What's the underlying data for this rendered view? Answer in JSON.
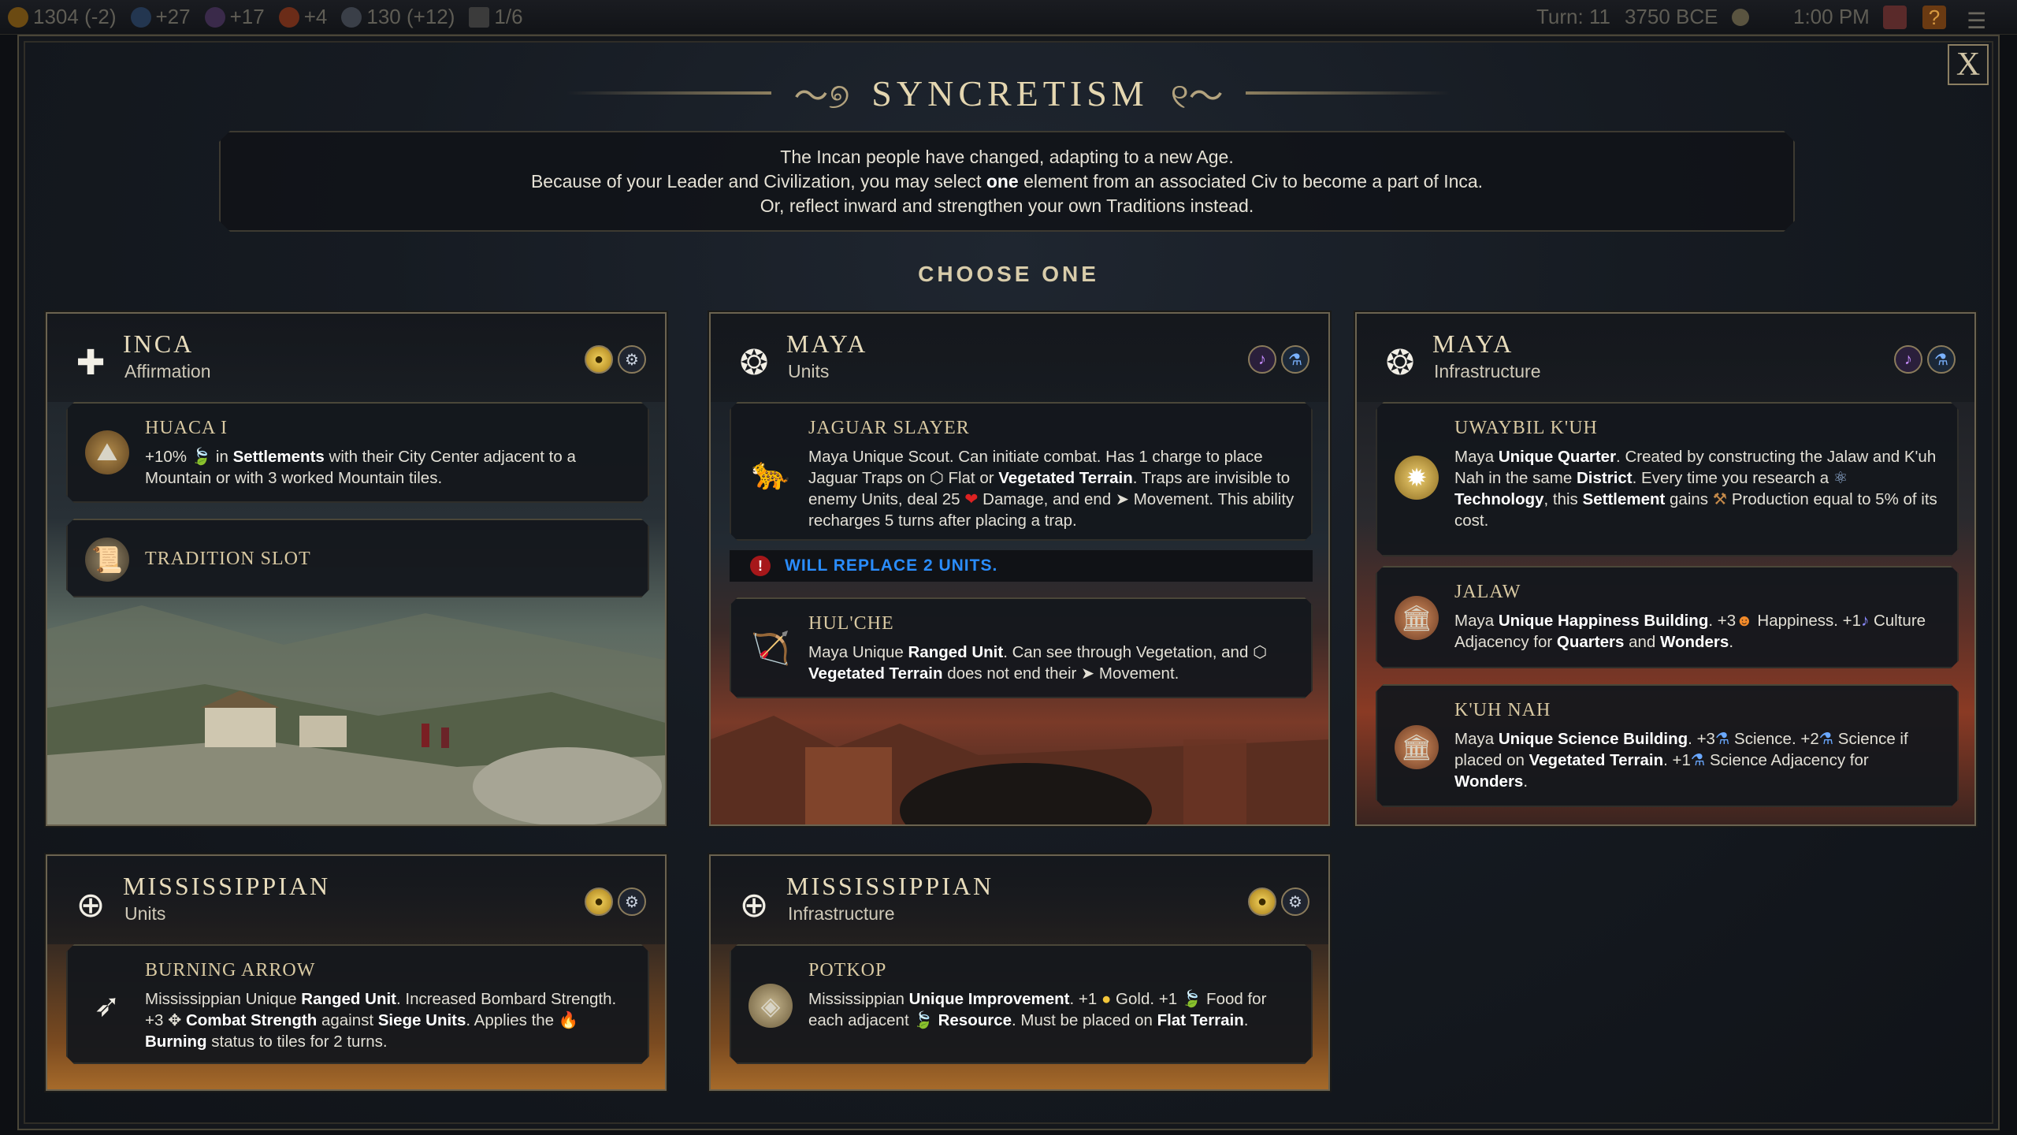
{
  "topbar": {
    "resources": [
      "1304 (-2)",
      "+27",
      "+17",
      "+4",
      "130 (+12)",
      "1/6"
    ],
    "turn": "Turn: 11",
    "year": "3750 BCE",
    "time": "1:00 PM",
    "help_label": "?"
  },
  "dialog": {
    "title": "SYNCRETISM",
    "close_label": "X",
    "intro_lines": [
      "The Incan people have changed, adapting to a new Age.",
      "Because of your Leader and Civilization, you may select ",
      "one",
      " element from an associated Civ to become a part of Inca.",
      "Or, reflect inward and strengthen your own Traditions instead."
    ],
    "choose_label": "CHOOSE ONE"
  },
  "cards": {
    "inca": {
      "name": "INCA",
      "subtitle": "Affirmation",
      "items": {
        "huaca": {
          "title": "HUACA I",
          "desc_a": "+10% ",
          "desc_b": " in ",
          "desc_c": "Settlements",
          "desc_d": " with their City Center adjacent to a Mountain or with 3 worked Mountain tiles."
        },
        "tradition": {
          "title": "TRADITION SLOT"
        }
      }
    },
    "maya_units": {
      "name": "MAYA",
      "subtitle": "Units",
      "items": {
        "jaguar": {
          "title": "JAGUAR SLAYER",
          "desc_a": "Maya Unique Scout. Can initiate combat. Has 1 charge to place Jaguar Traps on ",
          "desc_b": " Flat or ",
          "desc_c": "Vegetated Terrain",
          "desc_d": ". Traps are invisible to enemy Units, deal 25 ",
          "desc_e": " Damage, and end ",
          "desc_f": " Movement. This ability recharges 5 turns after placing a trap."
        },
        "warning": "WILL REPLACE 2 UNITS.",
        "hulche": {
          "title": "HUL'CHE",
          "desc_a": "Maya Unique ",
          "desc_b": "Ranged Unit",
          "desc_c": ". Can see through Vegetation, and ",
          "desc_d": "Vegetated Terrain",
          "desc_e": " does not end their ",
          "desc_f": " Movement."
        }
      }
    },
    "maya_infra": {
      "name": "MAYA",
      "subtitle": "Infrastructure",
      "items": {
        "uwaybil": {
          "title": "UWAYBIL K'UH",
          "desc_a": "Maya ",
          "desc_b": "Unique Quarter",
          "desc_c": ". Created by constructing the Jalaw and K'uh Nah in the same ",
          "desc_d": "District",
          "desc_e": ". Every time you research a ",
          "desc_f": "Technology",
          "desc_g": ", this ",
          "desc_h": "Settlement",
          "desc_i": " gains ",
          "desc_j": " Production equal to 5% of its cost."
        },
        "jalaw": {
          "title": "JALAW",
          "desc_a": "Maya ",
          "desc_b": "Unique Happiness Building",
          "desc_c": ". +3",
          "desc_d": " Happiness. +1",
          "desc_e": " Culture Adjacency for ",
          "desc_f": "Quarters",
          "desc_g": " and ",
          "desc_h": "Wonders",
          "desc_i": "."
        },
        "kuhnah": {
          "title": "K'UH NAH",
          "desc_a": "Maya ",
          "desc_b": "Unique Science Building",
          "desc_c": ". +3",
          "desc_d": " Science. +2",
          "desc_e": " Science if placed on ",
          "desc_f": "Vegetated Terrain",
          "desc_g": ". +1",
          "desc_h": " Science Adjacency for ",
          "desc_i": "Wonders",
          "desc_j": "."
        }
      }
    },
    "miss_units": {
      "name": "MISSISSIPPIAN",
      "subtitle": "Units",
      "items": {
        "arrow": {
          "title": "BURNING ARROW",
          "desc_a": "Mississippian Unique ",
          "desc_b": "Ranged Unit",
          "desc_c": ". Increased Bombard Strength. +3 ",
          "desc_d": "Combat Strength",
          "desc_e": " against ",
          "desc_f": "Siege Units",
          "desc_g": ". Applies the ",
          "desc_h": "Burning",
          "desc_i": " status to tiles for 2 turns."
        }
      }
    },
    "miss_infra": {
      "name": "MISSISSIPPIAN",
      "subtitle": "Infrastructure",
      "items": {
        "potkop": {
          "title": "POTKOP",
          "desc_a": "Mississippian ",
          "desc_b": "Unique Improvement",
          "desc_c": ". +1 ",
          "desc_d": " Gold. +1 ",
          "desc_e": " Food for each adjacent ",
          "desc_f": "Resource",
          "desc_g": ". Must be placed on ",
          "desc_h": "Flat Terrain",
          "desc_i": "."
        }
      }
    }
  },
  "colors": {
    "accent_gold": "#e4d6b0",
    "warning_blue": "#2a8dff",
    "warning_red": "#a6171a"
  }
}
